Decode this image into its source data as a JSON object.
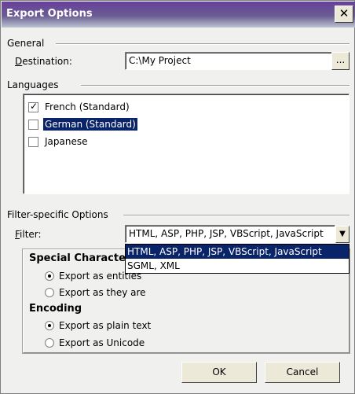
{
  "window": {
    "title": "Export Options",
    "close_glyph": "✕"
  },
  "general": {
    "group_label": "General",
    "destination_label": "Destination:",
    "destination_value": "C:\\My Project",
    "browse_label": "..."
  },
  "languages": {
    "group_label": "Languages",
    "items": [
      {
        "label": "French (Standard)",
        "checked": true
      },
      {
        "label": "German (Standard)",
        "checked": false,
        "selected": true
      },
      {
        "label": "Japanese",
        "checked": false
      }
    ]
  },
  "filter": {
    "group_label": "Filter-specific Options",
    "filter_label": "Filter:",
    "selected_value": "HTML, ASP, PHP, JSP, VBScript, JavaScript",
    "dropdown_options": [
      "HTML, ASP, PHP, JSP, VBScript, JavaScript",
      "SGML, XML"
    ]
  },
  "special_characters": {
    "heading": "Special Characters",
    "options": [
      "Export as entities",
      "Export as they are"
    ],
    "selected_index": 0
  },
  "encoding": {
    "heading": "Encoding",
    "options": [
      "Export as plain text",
      "Export as Unicode"
    ],
    "selected_index": 0
  },
  "buttons": {
    "ok": "OK",
    "cancel": "Cancel"
  },
  "colors": {
    "titlebar": "#67409a",
    "selection": "#0a246a",
    "face": "#f0f0ef"
  }
}
